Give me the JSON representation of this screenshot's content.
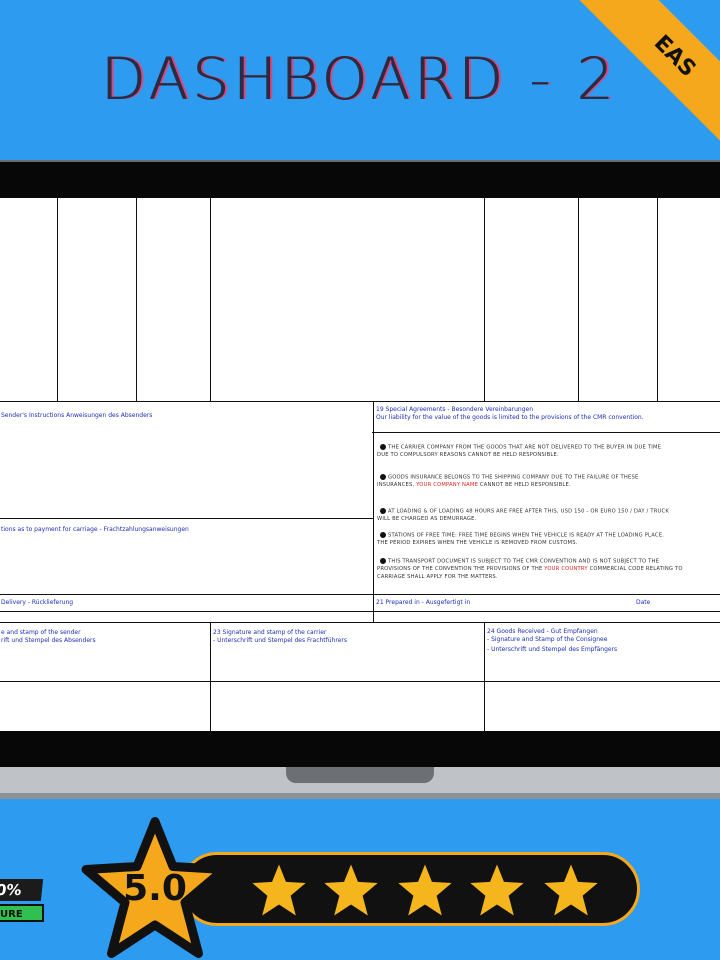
{
  "title": "DASHBOARD - 2",
  "ribbon": "EAS",
  "form": {
    "box_senders_instructions": "Sender's Instructions  Anweisungen des Absenders",
    "box_special_agreements_1": "19 Special Agreements -  Besondere Vereinbarungen",
    "box_special_agreements_2": "Our liability for the value of the goods is limited to the provisions of the CMR convention.",
    "box_payment": "tions as to payment for carriage - Frachtzahlungsanweisungen",
    "clause_1a": "THE CARRIER COMPANY FROM THE GOODS THAT ARE NOT DELIVERED TO THE BUYER IN DUE TIME",
    "clause_1b": "DUE TO COMPULSORY REASONS CANNOT BE HELD RESPONSIBLE.",
    "clause_2a": "GOODS INSURANCE BELONGS TO THE SHIPPING COMPANY DUE TO THE FAILURE OF THESE",
    "clause_2b_pre": "INSURANCES, ",
    "clause_2b_red": "YOUR COMPANY NAME",
    "clause_2b_post": "  CANNOT BE HELD RESPONSIBLE.",
    "clause_3a": "AT LOADING & OF LOADING 48 HOURS ARE FREE AFTER THIS, USD 150 - OR EURO 150 / DAY / TRUCK",
    "clause_3b": "WILL BE CHARGED AS DEMURRAGE.",
    "clause_4a": "STATIONS OF FREE TIME: FREE TIME BEGINS WHEN THE VEHICLE IS READY AT THE LOADING PLACE.",
    "clause_4b": "THE PERIOD EXPIRES WHEN THE VEHICLE IS REMOVED FROM CUSTOMS.",
    "clause_5a": "THIS TRANSPORT DOCUMENT IS SUBJECT TO THE CMR CONVENTION AND IS NOT SUBJECT TO THE",
    "clause_5b_pre": "PROVISIONS OF THE CONVENTION THE PROVISIONS OF THE ",
    "clause_5b_red": "YOUR COUNTRY",
    "clause_5b_post": " COMMERCIAL CODE RELATING TO",
    "clause_5c": "CARRIAGE SHALL APPLY FOR THE MATTERS.",
    "box_delivery": "Delivery - Rücklieferung",
    "box_prepared": "21 Prepared in - Ausgefertigt in",
    "box_date": "Date",
    "sig_sender_1": "e and stamp of the sender",
    "sig_sender_2": "rift und Stempel des Absenders",
    "sig_carrier_1": "23 Signature and stamp of the carrier",
    "sig_carrier_2": "- Unterschrift und Stempel des Frachtführers",
    "sig_consignee_1": "24 Goods Received -  Gut Empfangen",
    "sig_consignee_2": "- Signature and Stamp of the Consignee",
    "sig_consignee_3": "- Unterschrift und Stempel des Empfängers"
  },
  "rating": {
    "score": "5.0",
    "stars": 5
  },
  "badge": {
    "percent": "0%",
    "label": "URE"
  },
  "colors": {
    "background": "#2d9bf0",
    "accent": "#f5a81c",
    "label_blue": "#1c2fb3",
    "highlight_red": "#e02020",
    "secure_green": "#2fc04f"
  }
}
